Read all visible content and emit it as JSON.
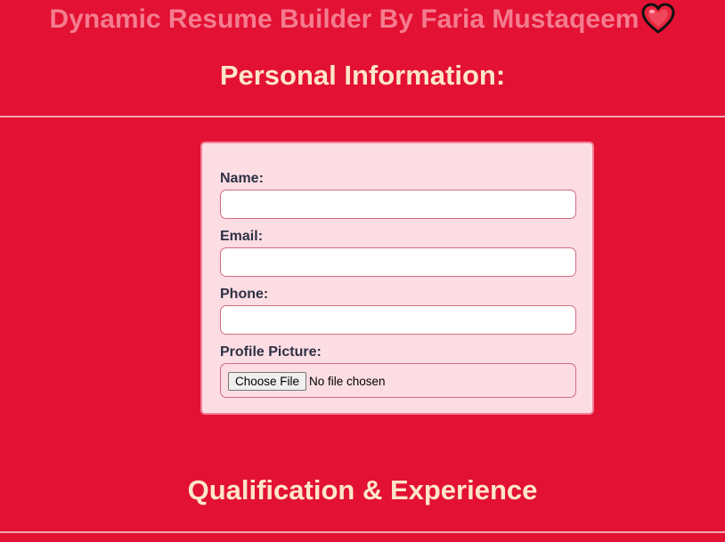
{
  "header": {
    "title": "Dynamic Resume Builder By Faria Mustaqeem",
    "title_icon": "heart-icon"
  },
  "sections": {
    "personal_heading": "Personal Information:",
    "qualification_heading": "Qualification & Experience"
  },
  "form": {
    "name_label": "Name:",
    "name_value": "",
    "email_label": "Email:",
    "email_value": "",
    "phone_label": "Phone:",
    "phone_value": "",
    "picture_label": "Profile Picture:",
    "choose_file_label": "Choose File",
    "file_status": "No file chosen"
  },
  "colors": {
    "page_background": "#e31133",
    "title_color": "#f47c8f",
    "heading_color": "#fde6c8",
    "card_background": "#fddde4",
    "card_border": "#f07e93",
    "label_color": "#2f3145"
  }
}
